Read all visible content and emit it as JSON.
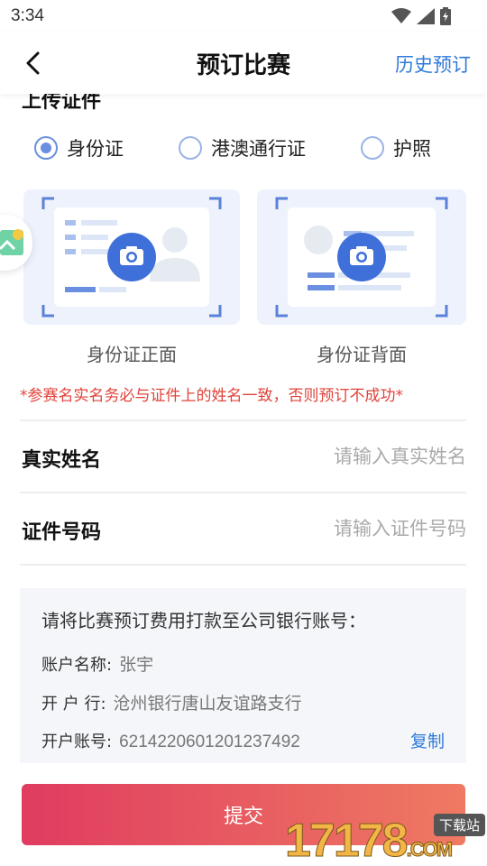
{
  "status": {
    "time": "3:34"
  },
  "nav": {
    "title": "预订比赛",
    "history": "历史预订"
  },
  "section": {
    "title": "上传证件"
  },
  "id_types": [
    {
      "label": "身份证",
      "checked": true
    },
    {
      "label": "港澳通行证",
      "checked": false
    },
    {
      "label": "护照",
      "checked": false
    }
  ],
  "cards": {
    "front_caption": "身份证正面",
    "back_caption": "身份证背面"
  },
  "notice": "*参赛名实名务必与证件上的姓名一致，否则预订不成功*",
  "form": {
    "name_label": "真实姓名",
    "name_placeholder": "请输入真实姓名",
    "id_label": "证件号码",
    "id_placeholder": "请输入证件号码"
  },
  "bank": {
    "heading": "请将比赛预订费用打款至公司银行账号：",
    "account_name_label": "账户名称:",
    "account_name": "张宇",
    "branch_label": "开 户 行:",
    "branch": "沧州银行唐山友谊路支行",
    "account_no_label": "开户账号:",
    "account_no": "6214220601201237492",
    "copy": "复制"
  },
  "submit": "提交",
  "watermark": {
    "number": "17178",
    "suffix": ".COM",
    "badge": "下载站"
  },
  "colors": {
    "accent": "#2f7bd9",
    "radio": "#6b8fe0",
    "warning": "#e0433a",
    "submit_start": "#e03c60",
    "submit_end": "#ef7a62"
  }
}
